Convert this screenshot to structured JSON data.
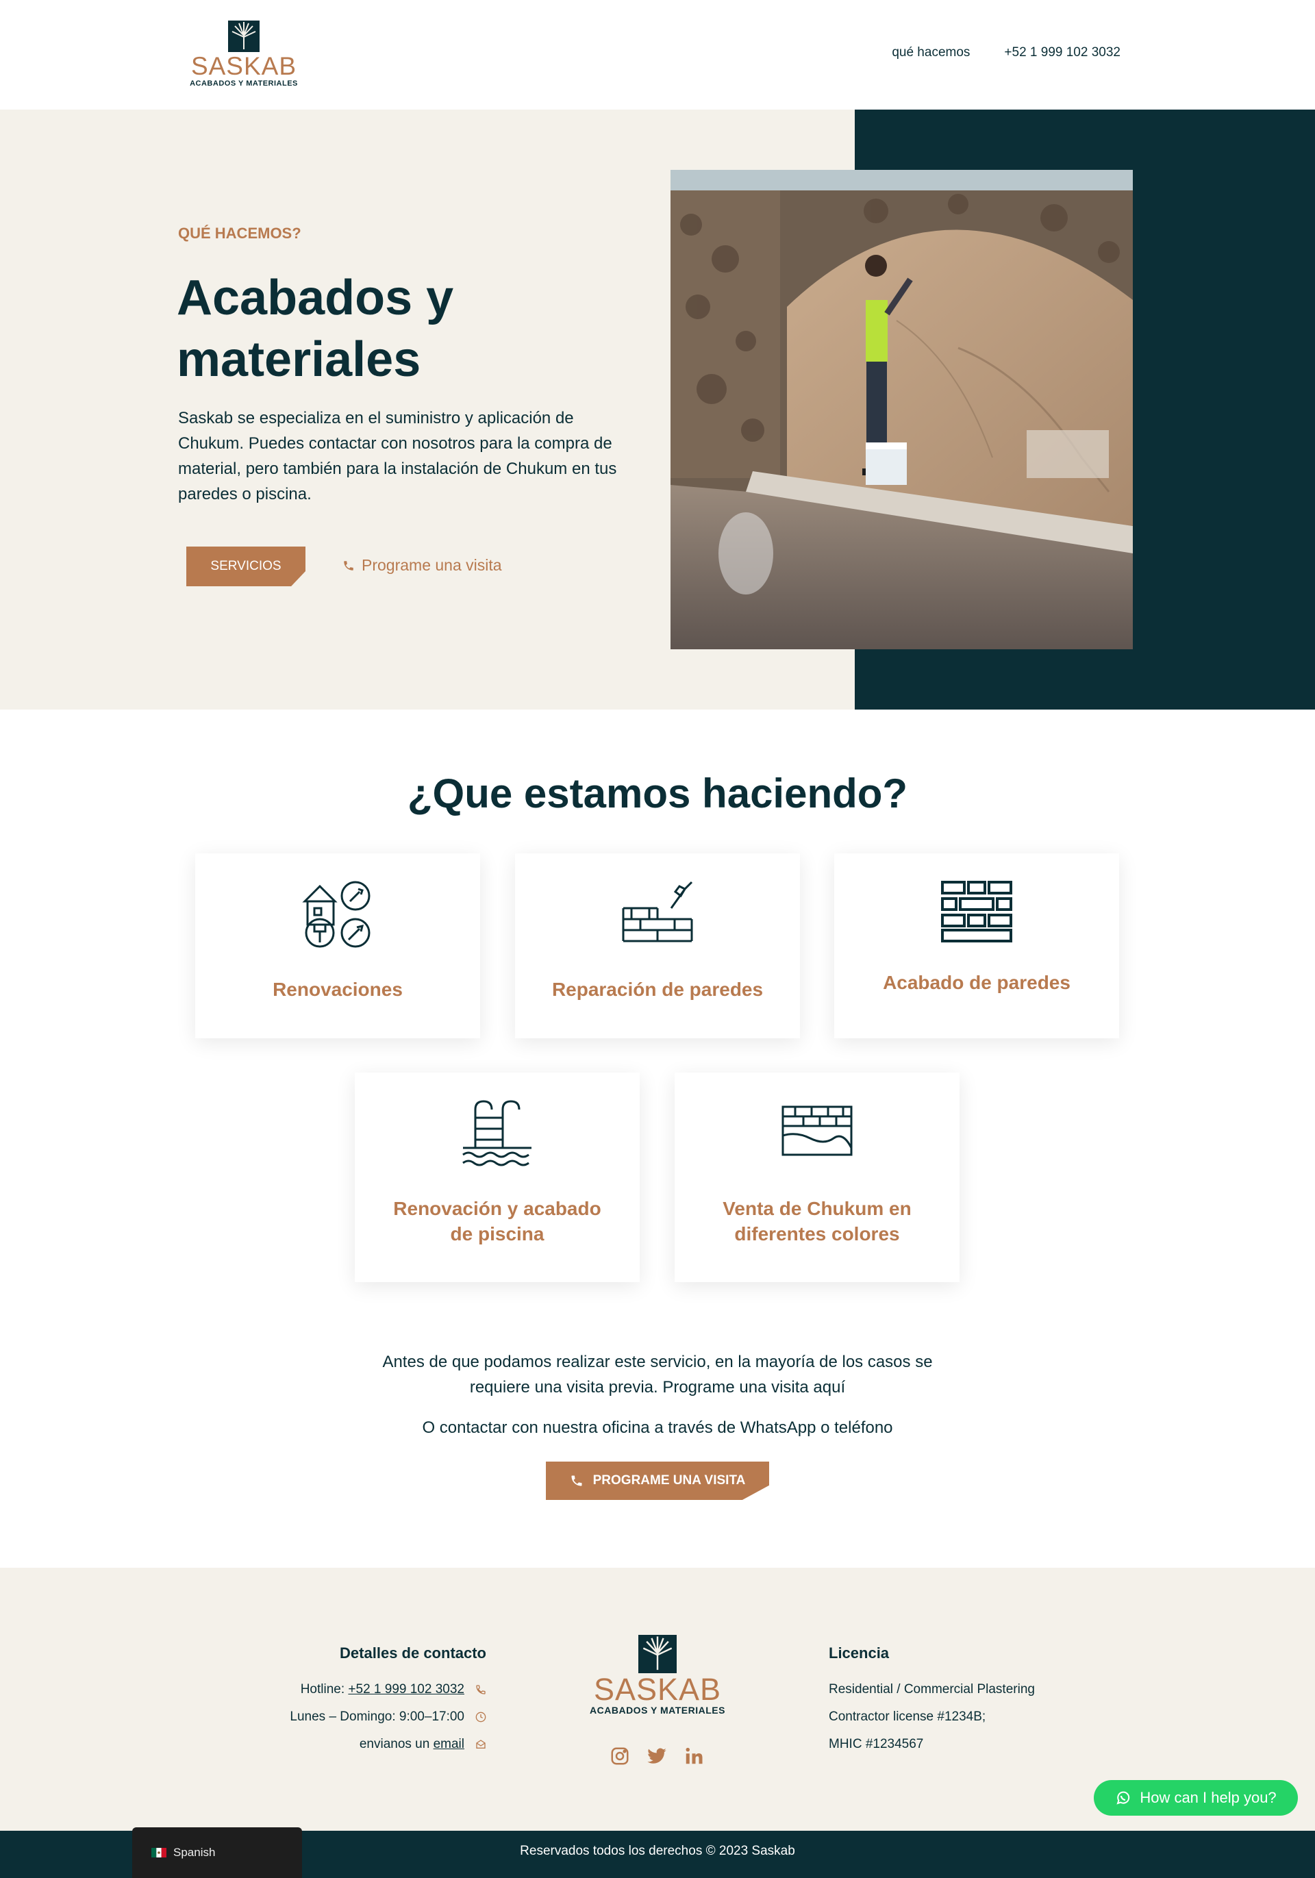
{
  "header": {
    "logo_word": "SASKAB",
    "logo_sub": "ACABADOS Y MATERIALES",
    "nav": [
      {
        "label": "qué hacemos"
      },
      {
        "label": "+52 1 999 102 3032"
      }
    ]
  },
  "hero": {
    "eyebrow": "QUÉ HACEMOS?",
    "title": "Acabados y materiales",
    "text": "Saskab se especializa en el suministro y aplicación de Chukum. Puedes contactar con nosotros para la compra de material, pero también para la instalación de Chukum en tus paredes o piscina.",
    "btn_services": "SERVICIOS",
    "btn_visit": "Programe una visita"
  },
  "services": {
    "title": "¿Que estamos haciendo?",
    "cards": [
      {
        "label": "Renovaciones",
        "icon": "renovation-icon"
      },
      {
        "label": "Reparación de paredes",
        "icon": "wall-repair-icon"
      },
      {
        "label": "Acabado de paredes",
        "icon": "brick-wall-icon"
      },
      {
        "label": "Renovación y acabado de piscina",
        "icon": "pool-ladder-icon"
      },
      {
        "label": "Venta de Chukum en diferentes colores",
        "icon": "chukum-wall-icon"
      }
    ],
    "note1": "Antes de que podamos realizar este servicio, en la mayoría de los casos se requiere una visita previa. Programe una visita aquí",
    "note2": "O contactar con nuestra oficina a través de WhatsApp o teléfono",
    "btn_visit": "PROGRAME UNA VISITA"
  },
  "footer": {
    "contact_title": "Detalles de contacto",
    "hotline_prefix": "Hotline: ",
    "hotline": "+52 1 999 102 3032",
    "hours": "Lunes – Domingo: 9:00–17:00",
    "email_prefix": "envianos un ",
    "email_link": "email",
    "license_title": "Licencia",
    "license_lines": [
      "Residential / Commercial Plastering",
      "Contractor license #1234B;",
      "MHIC #1234567"
    ],
    "copyright": "Reservados todos los derechos © 2023 Saskab"
  },
  "widgets": {
    "language": "Spanish",
    "whatsapp": "How can I help you?"
  },
  "colors": {
    "primary_dark": "#0b2e36",
    "accent": "#b87a4f",
    "cream": "#f4f1ea",
    "whatsapp": "#25d366"
  }
}
